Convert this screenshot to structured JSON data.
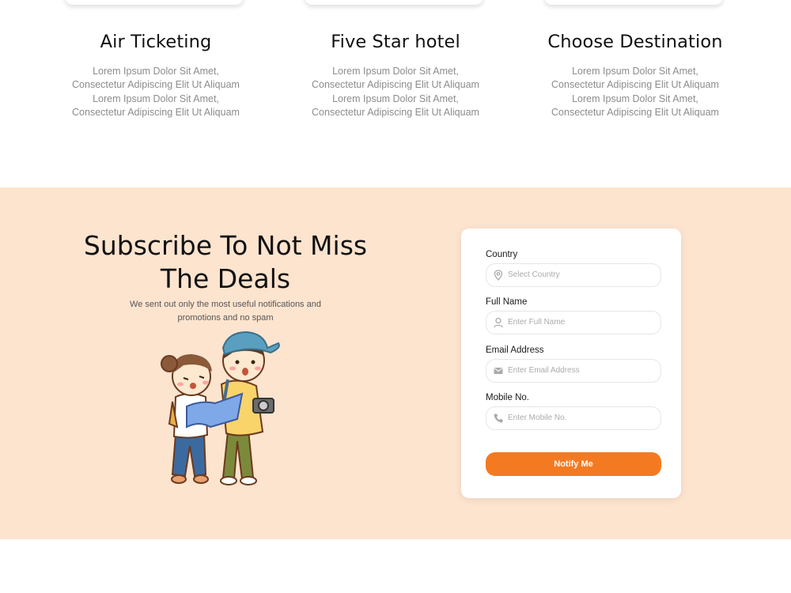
{
  "features": [
    {
      "title": "Air Ticketing",
      "text": "Lorem Ipsum Dolor Sit Amet, Consectetur Adipiscing Elit Ut Aliquam Lorem Ipsum Dolor Sit Amet, Consectetur Adipiscing Elit Ut Aliquam"
    },
    {
      "title": "Five Star hotel",
      "text": "Lorem Ipsum Dolor Sit Amet, Consectetur Adipiscing Elit Ut Aliquam Lorem Ipsum Dolor Sit Amet, Consectetur Adipiscing Elit Ut Aliquam"
    },
    {
      "title": "Choose Destination",
      "text": "Lorem Ipsum Dolor Sit Amet, Consectetur Adipiscing Elit Ut Aliquam Lorem Ipsum Dolor Sit Amet, Consectetur Adipiscing Elit Ut Aliquam"
    }
  ],
  "subscribe": {
    "title": "Subscribe To Not Miss The Deals",
    "text": "We sent out only the most useful notifications and promotions and no spam",
    "illustration_icon": "travelers-illustration"
  },
  "form": {
    "fields": [
      {
        "label": "Country",
        "placeholder": "Select Country",
        "icon": "location-pin-icon"
      },
      {
        "label": "Full Name",
        "placeholder": "Enter Full Name",
        "icon": "user-icon"
      },
      {
        "label": "Email Address",
        "placeholder": "Enter Email Address",
        "icon": "mail-icon"
      },
      {
        "label": "Mobile No.",
        "placeholder": "Enter Mobile No.",
        "icon": "phone-icon"
      }
    ],
    "submit_label": "Notify Me"
  },
  "colors": {
    "band_bg": "#fde4cf",
    "accent": "#f47a22",
    "muted_text": "#8c8c8c"
  }
}
